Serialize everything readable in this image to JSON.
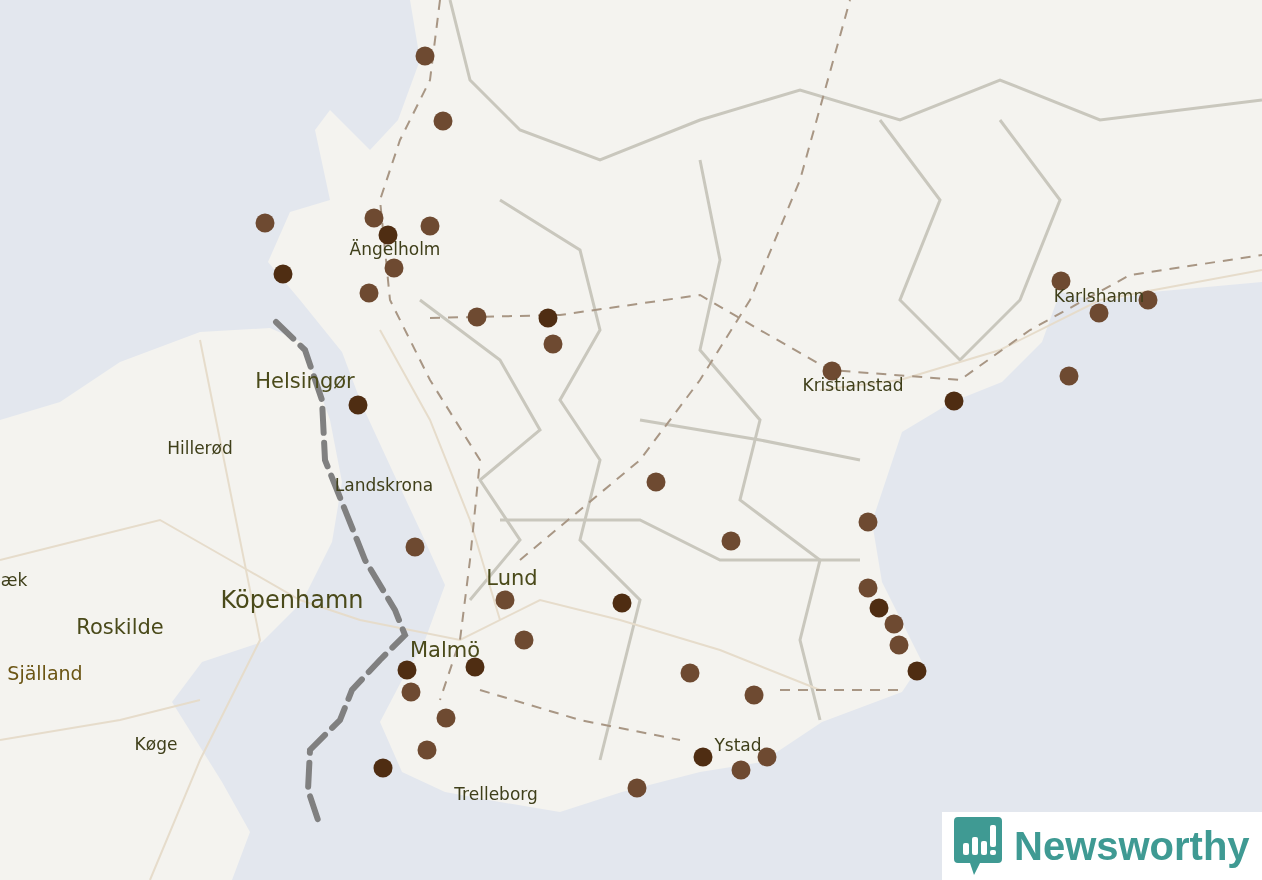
{
  "map": {
    "labels": [
      {
        "text": "Ängelholm",
        "kind": "town"
      },
      {
        "text": "Karlshamn",
        "kind": "town"
      },
      {
        "text": "Helsingør",
        "kind": "city"
      },
      {
        "text": "Kristianstad",
        "kind": "town"
      },
      {
        "text": "Hillerød",
        "kind": "town"
      },
      {
        "text": "Landskrona",
        "kind": "town"
      },
      {
        "text": "æk",
        "kind": "town"
      },
      {
        "text": "Lund",
        "kind": "city"
      },
      {
        "text": "Köpenhamn",
        "kind": "major"
      },
      {
        "text": "Roskilde",
        "kind": "city"
      },
      {
        "text": "Malmö",
        "kind": "city"
      },
      {
        "text": "Själland",
        "kind": "region"
      },
      {
        "text": "Køge",
        "kind": "town"
      },
      {
        "text": "Ystad",
        "kind": "town"
      },
      {
        "text": "Trelleborg",
        "kind": "town"
      }
    ]
  },
  "logo": {
    "text": "Newsworthy"
  }
}
